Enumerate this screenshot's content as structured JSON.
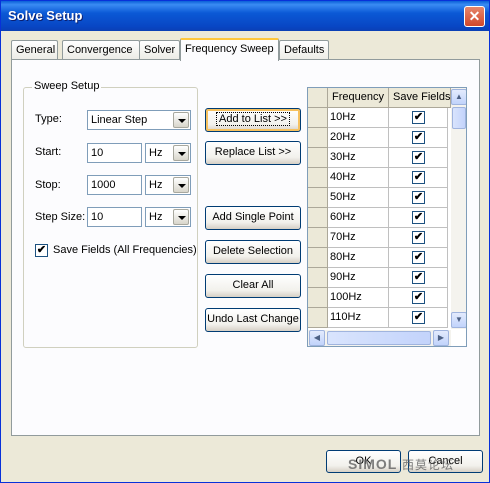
{
  "window": {
    "title": "Solve Setup",
    "close_glyph": "✕"
  },
  "tabs": [
    {
      "label": "General",
      "active": false
    },
    {
      "label": "Convergence",
      "active": false
    },
    {
      "label": "Solver",
      "active": false
    },
    {
      "label": "Frequency Sweep",
      "active": true
    },
    {
      "label": "Defaults",
      "active": false
    }
  ],
  "sweep_setup": {
    "group_label": "Sweep Setup",
    "type_label": "Type:",
    "type_value": "Linear Step",
    "start_label": "Start:",
    "start_value": "10",
    "start_unit": "Hz",
    "stop_label": "Stop:",
    "stop_value": "1000",
    "stop_unit": "Hz",
    "step_label": "Step Size:",
    "step_value": "10",
    "step_unit": "Hz",
    "save_fields_label": "Save Fields (All Frequencies)",
    "save_fields_checked": true
  },
  "actions": {
    "add_to_list": "Add to List >>",
    "replace_list": "Replace List >>",
    "add_single_point": "Add Single Point",
    "delete_selection": "Delete Selection",
    "clear_all": "Clear All",
    "undo_last_change": "Undo Last Change"
  },
  "grid": {
    "col_frequency": "Frequency",
    "col_save_fields": "Save Fields",
    "rows": [
      {
        "frequency": "10Hz",
        "save_fields": true
      },
      {
        "frequency": "20Hz",
        "save_fields": true
      },
      {
        "frequency": "30Hz",
        "save_fields": true
      },
      {
        "frequency": "40Hz",
        "save_fields": true
      },
      {
        "frequency": "50Hz",
        "save_fields": true
      },
      {
        "frequency": "60Hz",
        "save_fields": true
      },
      {
        "frequency": "70Hz",
        "save_fields": true
      },
      {
        "frequency": "80Hz",
        "save_fields": true
      },
      {
        "frequency": "90Hz",
        "save_fields": true
      },
      {
        "frequency": "100Hz",
        "save_fields": true
      },
      {
        "frequency": "110Hz",
        "save_fields": true
      }
    ]
  },
  "footer": {
    "ok": "OK",
    "cancel": "Cancel"
  },
  "watermark": {
    "latin": "SIMOL",
    "cn": "西莫论坛"
  },
  "icons": {
    "check": "✔",
    "scroll_up": "▲",
    "scroll_down": "▼",
    "scroll_left": "◀",
    "scroll_right": "▶"
  },
  "colors": {
    "titlebar": "#0846c4",
    "dialog_bg": "#ece9d8",
    "active_tab_accent": "#ffc73c"
  }
}
